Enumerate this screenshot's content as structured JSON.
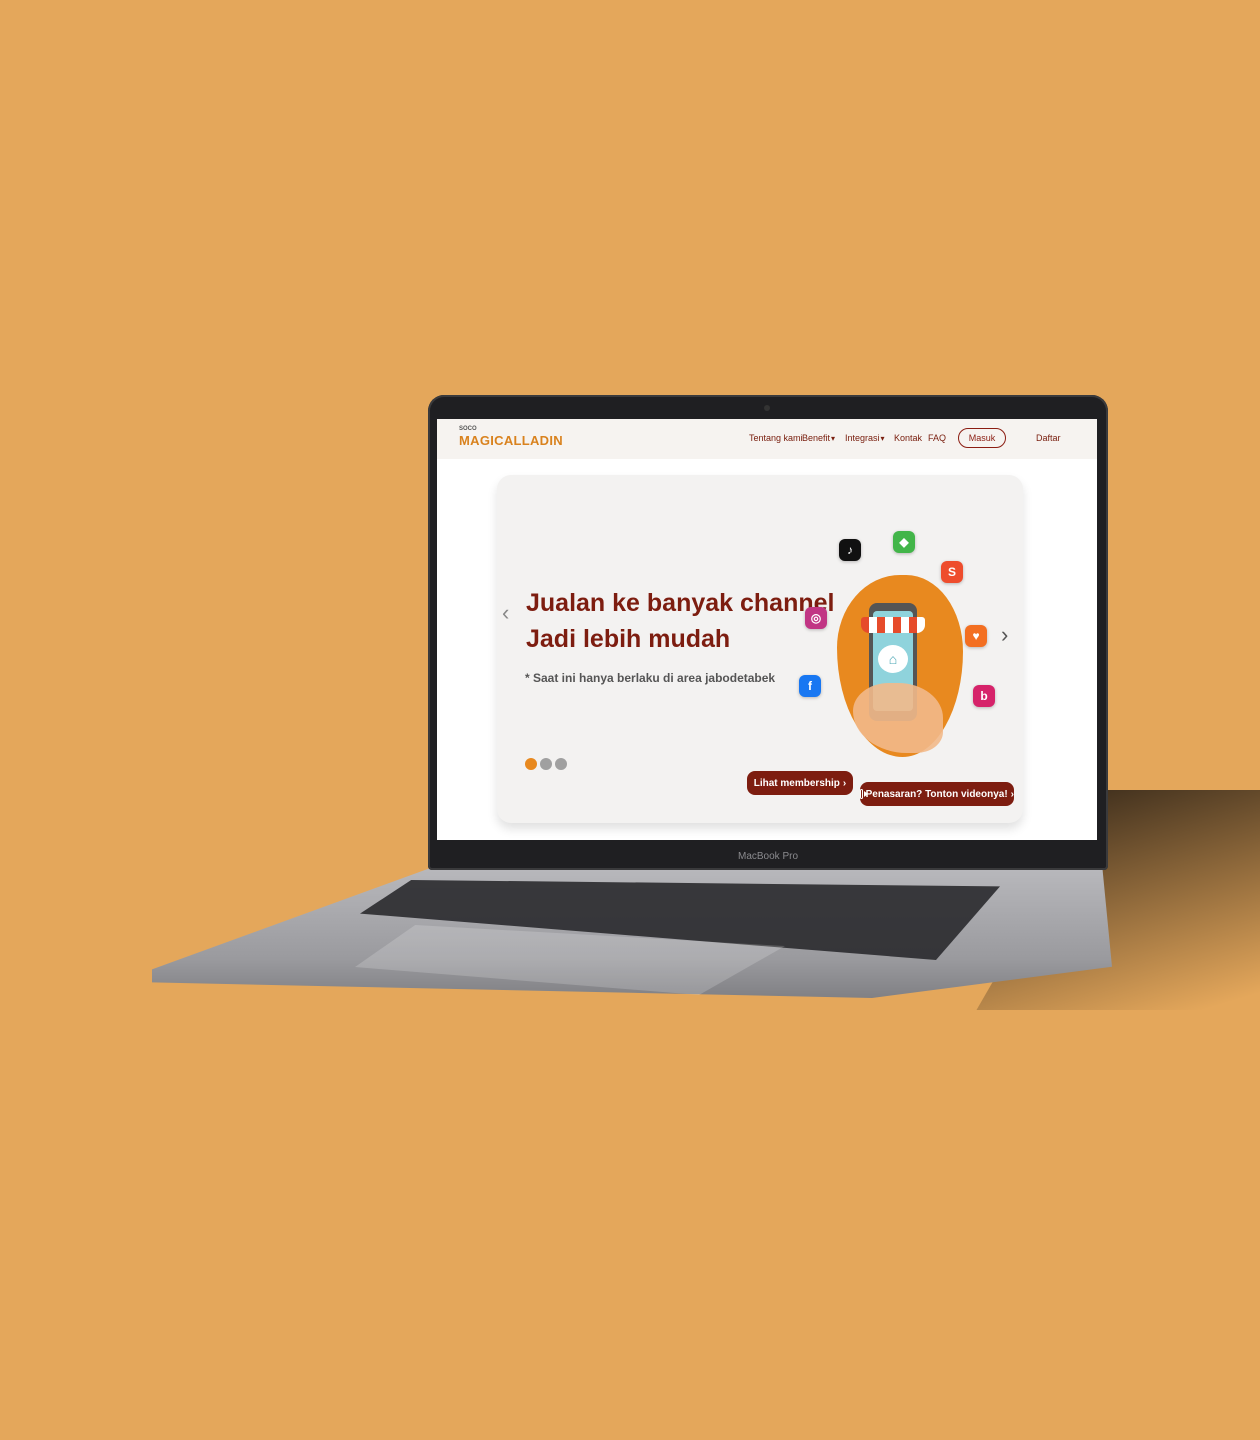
{
  "device": {
    "label": "MacBook Pro"
  },
  "header": {
    "logo_top": "SOCO",
    "logo_main": "MAGICALLADIN",
    "nav": [
      {
        "label": "Tentang kami",
        "has_dropdown": false
      },
      {
        "label": "Benefit",
        "has_dropdown": true
      },
      {
        "label": "Integrasi",
        "has_dropdown": true
      },
      {
        "label": "Kontak",
        "has_dropdown": false
      },
      {
        "label": "FAQ",
        "has_dropdown": false
      }
    ],
    "login_label": "Masuk",
    "register_label": "Daftar"
  },
  "hero": {
    "title_line1": "Jualan ke banyak channel",
    "title_line2": "Jadi lebih mudah",
    "note": "* Saat ini hanya berlaku di area jabodetabek",
    "carousel_total": 3,
    "carousel_active": 1,
    "membership_button": "Lihat membership",
    "video_button": "Penasaran? Tonton videonya!",
    "chevron_right": "›",
    "prev_arrow": "‹",
    "next_arrow": "›"
  },
  "channels": [
    {
      "name": "tiktok-icon",
      "glyph": "♪",
      "color": "#111111"
    },
    {
      "name": "tokopedia-icon",
      "glyph": "◆",
      "color": "#42b549"
    },
    {
      "name": "shopee-icon",
      "glyph": "S",
      "color": "#ee4d2d"
    },
    {
      "name": "instagram-icon",
      "glyph": "◎",
      "color": "#c13584"
    },
    {
      "name": "lazada-icon",
      "glyph": "♥",
      "color": "#f36f21"
    },
    {
      "name": "facebook-icon",
      "glyph": "f",
      "color": "#1877f2"
    },
    {
      "name": "blibli-icon",
      "glyph": "b",
      "color": "#d6236a"
    }
  ],
  "colors": {
    "background": "#e4a75b",
    "brand_orange": "#d9821e",
    "brand_maroon": "#7d1d10",
    "dot_active": "#e8891f",
    "dot_inactive": "#a0a0a0"
  }
}
